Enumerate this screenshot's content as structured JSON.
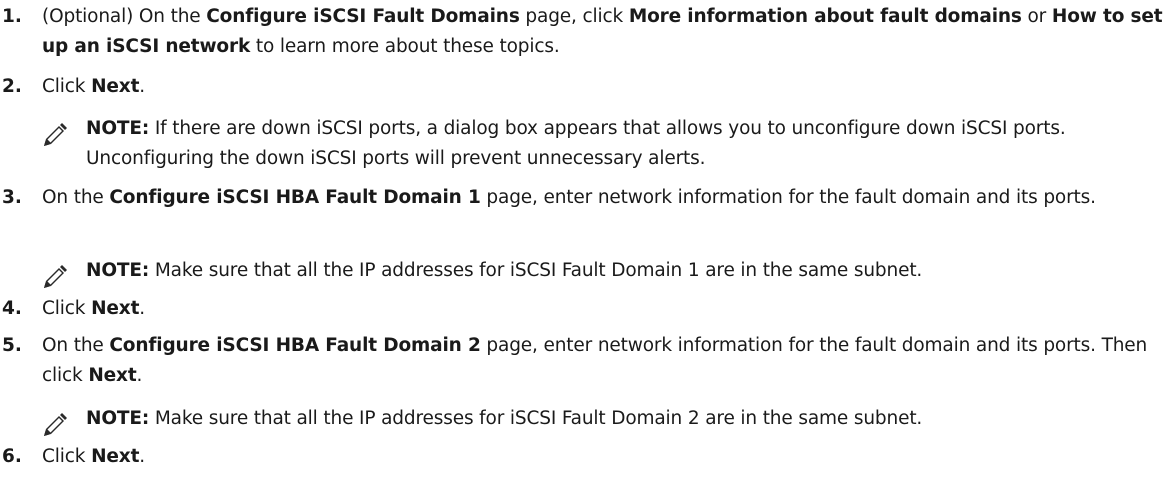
{
  "steps": [
    {
      "number": "1.",
      "parts": [
        {
          "t": "(Optional) On the ",
          "b": false
        },
        {
          "t": "Configure iSCSI Fault Domains",
          "b": true
        },
        {
          "t": " page, click ",
          "b": false
        },
        {
          "t": "More information about fault domains",
          "b": true
        },
        {
          "t": " or ",
          "b": false
        },
        {
          "t": "How to set up an iSCSI network",
          "b": true
        },
        {
          "t": " to learn more about these topics.",
          "b": false
        }
      ]
    },
    {
      "number": "2.",
      "parts": [
        {
          "t": "Click ",
          "b": false
        },
        {
          "t": "Next",
          "b": true
        },
        {
          "t": ".",
          "b": false
        }
      ],
      "note": {
        "label": "NOTE:",
        "text": " If there are down iSCSI ports, a dialog box appears that allows you to unconfigure down iSCSI ports. Unconfiguring the down iSCSI ports will prevent unnecessary alerts."
      }
    },
    {
      "number": "3.",
      "parts": [
        {
          "t": "On the ",
          "b": false
        },
        {
          "t": "Configure iSCSI HBA Fault Domain 1",
          "b": true
        },
        {
          "t": " page, enter network information for the fault domain and its ports.",
          "b": false
        }
      ],
      "note": {
        "label": "NOTE:",
        "text": " Make sure that all the IP addresses for iSCSI Fault Domain 1 are in the same subnet."
      }
    },
    {
      "number": "4.",
      "parts": [
        {
          "t": "Click ",
          "b": false
        },
        {
          "t": "Next",
          "b": true
        },
        {
          "t": ".",
          "b": false
        }
      ]
    },
    {
      "number": "5.",
      "parts": [
        {
          "t": "On the ",
          "b": false
        },
        {
          "t": "Configure iSCSI HBA Fault Domain 2",
          "b": true
        },
        {
          "t": " page, enter network information for the fault domain and its ports. Then click ",
          "b": false
        },
        {
          "t": "Next",
          "b": true
        },
        {
          "t": ".",
          "b": false
        }
      ],
      "note": {
        "label": "NOTE:",
        "text": " Make sure that all the IP addresses for iSCSI Fault Domain 2 are in the same subnet."
      }
    },
    {
      "number": "6.",
      "parts": [
        {
          "t": "Click ",
          "b": false
        },
        {
          "t": "Next",
          "b": true
        },
        {
          "t": ".",
          "b": false
        }
      ]
    }
  ]
}
